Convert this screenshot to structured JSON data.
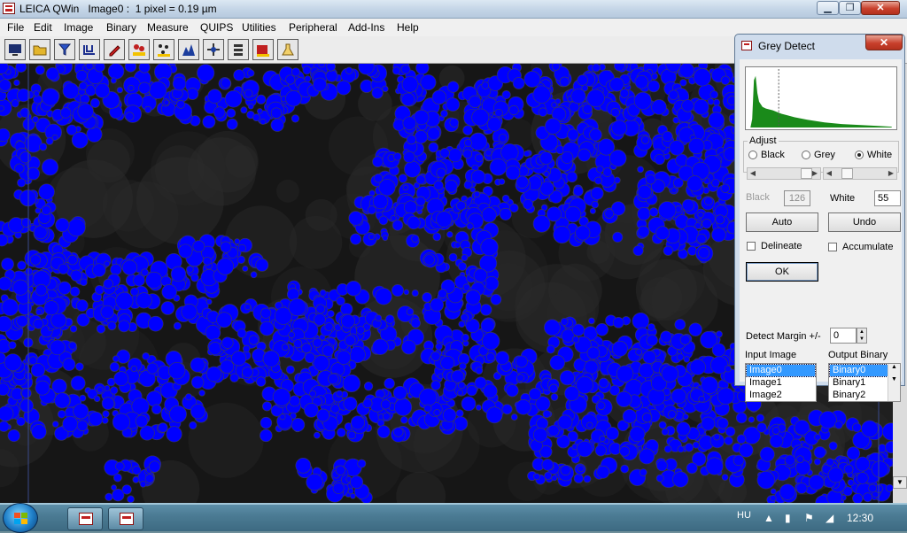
{
  "window": {
    "title": "LEICA QWin   Image0 :  1 pixel = 0.19 µm",
    "minimize_glyph": "▁",
    "maximize_glyph": "❐",
    "close_glyph": "✕"
  },
  "menu": {
    "items": [
      "File",
      "Edit",
      "Image",
      "Binary",
      "Measure",
      "QUIPS",
      "Utilities",
      "Peripheral",
      "Add-Ins",
      "Help"
    ]
  },
  "toolbar": {
    "icons": [
      "monitor-icon",
      "open-folder-icon",
      "filter-icon",
      "pipeline-icon",
      "pencil-icon",
      "measure-objects-icon",
      "particles-icon",
      "histogram-icon",
      "process-icon",
      "list-icon",
      "export-icon",
      "flask-icon"
    ]
  },
  "dialog": {
    "title": "Grey Detect",
    "close_glyph": "✕",
    "adjust_label": "Adjust",
    "radio": {
      "black": "Black",
      "grey": "Grey",
      "white": "White",
      "selected": "White"
    },
    "black_label": "Black",
    "black_value": "126",
    "white_label": "White",
    "white_value": "55",
    "auto_label": "Auto",
    "undo_label": "Undo",
    "delineate_label": "Delineate",
    "accumulate_label": "Accumulate",
    "ok_label": "OK",
    "margin_label": "Detect Margin +/-",
    "margin_value": "0",
    "input_label": "Input Image",
    "output_label": "Output Binary",
    "input_items": [
      "Image0",
      "Image1",
      "Image2"
    ],
    "output_items": [
      "Binary0",
      "Binary1",
      "Binary2"
    ],
    "input_selected": "Image0",
    "output_selected": "Binary0",
    "histogram_color": "#1a8a1a",
    "threshold_line_level": 0.2
  },
  "image": {
    "detect_color": "#0000ff",
    "background_color": "#161616"
  },
  "taskbar": {
    "language": "HU",
    "clock": "12:30"
  }
}
